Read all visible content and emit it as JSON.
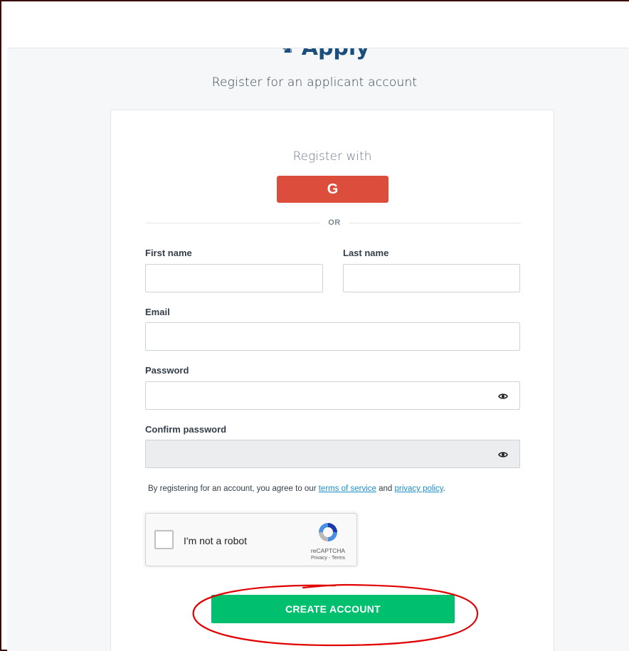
{
  "header": {
    "brand_name": "Apply"
  },
  "page": {
    "subtitle": "Register for an applicant account"
  },
  "register": {
    "heading": "Register with",
    "google_label": "G",
    "or_label": "OR"
  },
  "form": {
    "first_name": {
      "label": "First name",
      "value": ""
    },
    "last_name": {
      "label": "Last name",
      "value": ""
    },
    "email": {
      "label": "Email",
      "value": ""
    },
    "password": {
      "label": "Password",
      "value": ""
    },
    "confirm_password": {
      "label": "Confirm password",
      "value": ""
    }
  },
  "terms": {
    "prefix": "By registering for an account, you agree to our ",
    "tos_link": "terms of service",
    "middle": " and ",
    "privacy_link": "privacy policy",
    "suffix": "."
  },
  "recaptcha": {
    "checkbox_label": "I'm not a robot",
    "brand": "reCAPTCHA",
    "links": "Privacy - Terms"
  },
  "actions": {
    "create_account_label": "CREATE ACCOUNT"
  },
  "colors": {
    "google_red": "#dc4e3b",
    "primary_green": "#00bf6f",
    "link_blue": "#1a8fc9",
    "annotation_red": "#e00000"
  }
}
